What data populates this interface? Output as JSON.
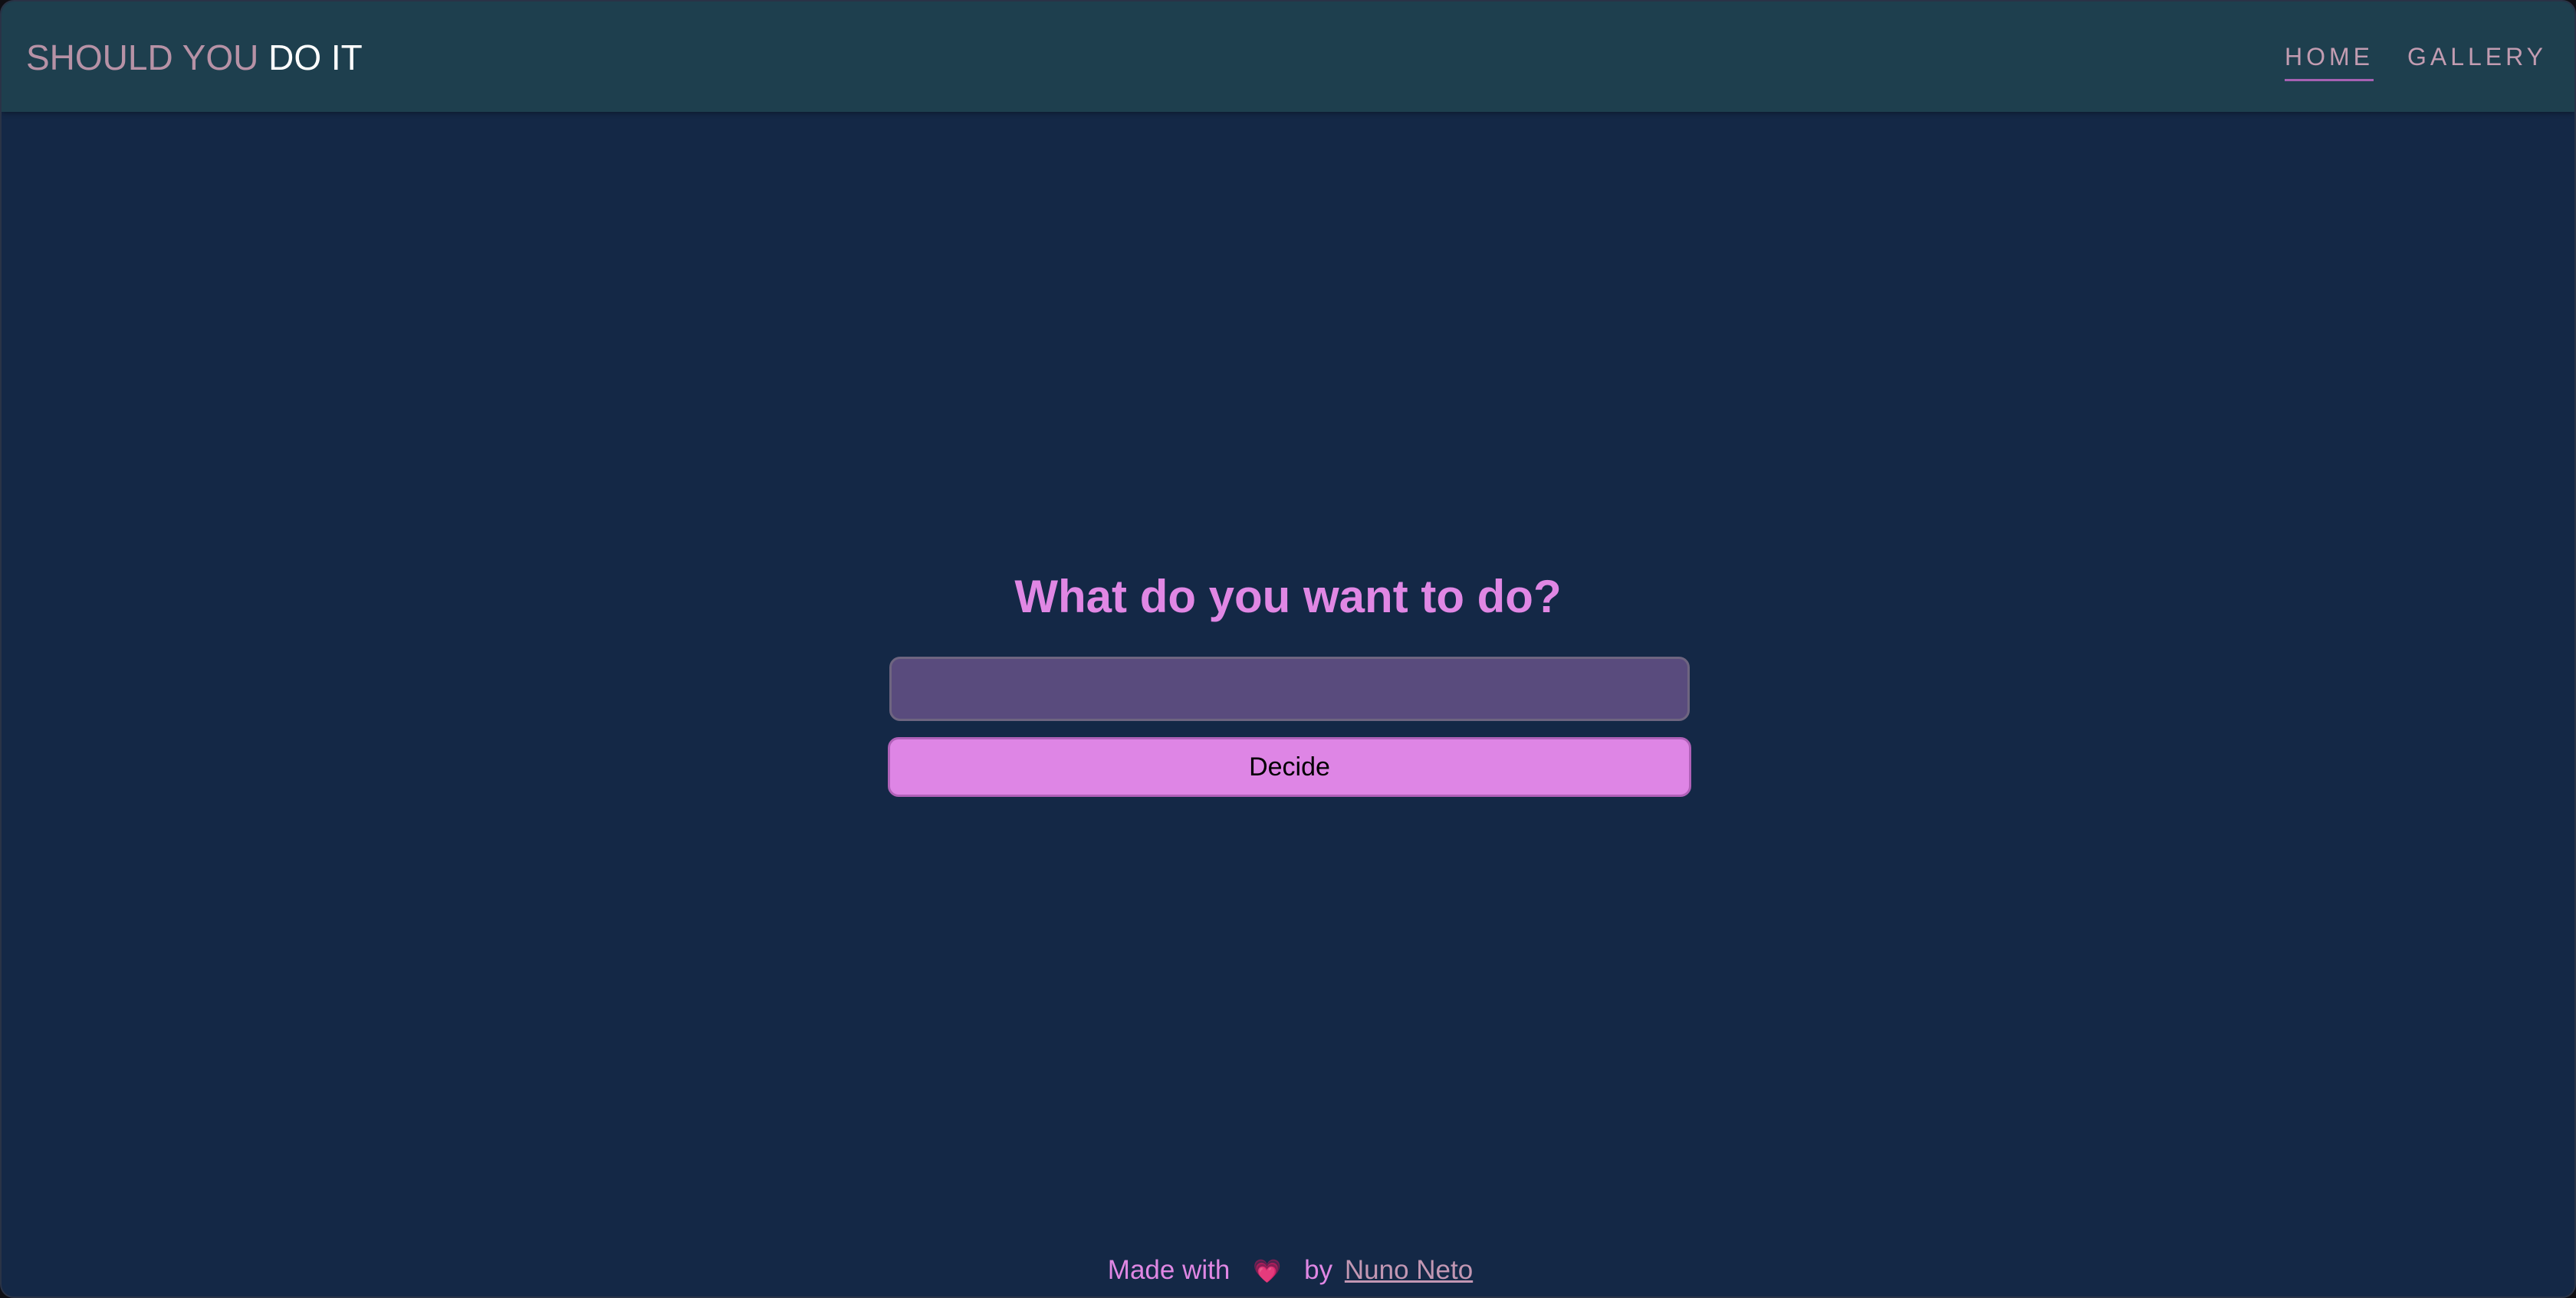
{
  "header": {
    "brand_part1": "SHOULD YOU",
    "brand_part2": "DO IT",
    "nav": [
      {
        "label": "HOME",
        "active": true
      },
      {
        "label": "GALLERY",
        "active": false
      }
    ]
  },
  "main": {
    "heading": "What do you want to do?",
    "input_value": "",
    "input_placeholder": "",
    "button_label": "Decide"
  },
  "footer": {
    "made_with": "Made with",
    "heart_icon": "sparkling-heart-icon",
    "by": "by",
    "author": "Nuno Neto"
  },
  "colors": {
    "page_bg": "#142846",
    "navbar_bg": "#1e3f4e",
    "accent_pink": "#e087e4",
    "input_bg": "#594b7d",
    "button_bg": "#de85e5"
  }
}
